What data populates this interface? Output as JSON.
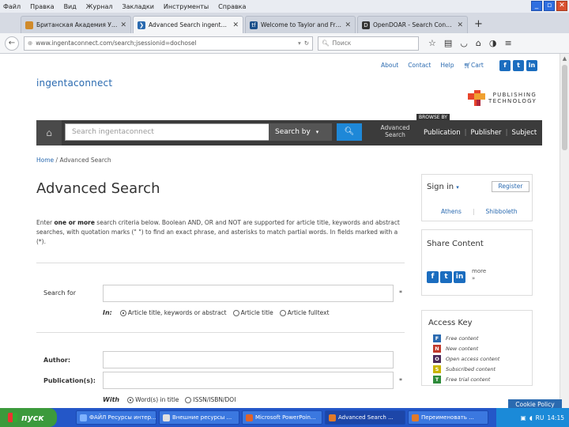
{
  "browser": {
    "menu": [
      "Файл",
      "Правка",
      "Вид",
      "Журнал",
      "Закладки",
      "Инструменты",
      "Справка"
    ],
    "window_buttons": [
      "_",
      "▫",
      "✕"
    ],
    "tabs": [
      {
        "title": "Британская Академия Уни...",
        "icon_color": "#d08a2a",
        "icon": "",
        "active": false
      },
      {
        "title": "Advanced Search ingentaco...",
        "icon_color": "#2a6ab0",
        "icon": "❯",
        "active": true
      },
      {
        "title": "Welcome to Taylor and Francis O...",
        "icon_color": "#1a4f8a",
        "icon": "tf",
        "active": false
      },
      {
        "title": "OpenDOAR - Search Content",
        "icon_color": "#333333",
        "icon": "D",
        "active": false
      }
    ],
    "new_tab": "+",
    "url": "www.ingentaconnect.com/search;jsessionid=dochosel",
    "search_placeholder": "Поиск"
  },
  "site": {
    "top_links": [
      "About",
      "Contact",
      "Help"
    ],
    "cart_label": "Cart",
    "social": [
      "f",
      "t",
      "in"
    ],
    "logo": "ingentaconnect",
    "publisher_logo": {
      "line1": "PUBLISHING",
      "line2": "TECHNOLOGY"
    },
    "browse_by_label": "BROWSE BY",
    "search_placeholder": "Search ingentaconnect",
    "search_by_label": "Search by",
    "advanced_search_line1": "Advanced",
    "advanced_search_line2": "Search",
    "browse_links": [
      "Publication",
      "Publisher",
      "Subject"
    ]
  },
  "main": {
    "breadcrumb_home": "Home",
    "breadcrumb_current": "/ Advanced Search",
    "title": "Advanced Search",
    "intro_p1": "Enter ",
    "intro_bold": "one or more",
    "intro_p2": " search criteria below. Boolean AND, OR and NOT are supported for article title, keywords and abstract searches, with quotation marks (\" \") to find an exact phrase, and asterisks to match partial words. In fields marked with a (*).",
    "search_for_label": "Search for",
    "in_label": "In:",
    "in_options": [
      {
        "label": "Article title, keywords or abstract",
        "selected": true
      },
      {
        "label": "Article title",
        "selected": false
      },
      {
        "label": "Article fulltext",
        "selected": false
      }
    ],
    "author_label": "Author:",
    "publication_label": "Publication(s):",
    "with_label": "With",
    "with_options": [
      {
        "label": "Word(s) in title",
        "selected": true
      },
      {
        "label": "ISSN/ISBN/DOI",
        "selected": false
      }
    ],
    "required_marker": "*"
  },
  "sidebar": {
    "signin_label": "Sign in",
    "signin_caret": "▾",
    "register_label": "Register",
    "athens_label": "Athens",
    "shibboleth_label": "Shibboleth",
    "share_title": "Share Content",
    "share_icons": [
      "f",
      "t",
      "in"
    ],
    "more_label_line1": "more",
    "more_label_line2": "»",
    "access_title": "Access Key",
    "access_items": [
      {
        "code": "F",
        "label": "Free content",
        "color": "#2a6ab0"
      },
      {
        "code": "N",
        "label": "New content",
        "color": "#c0392b"
      },
      {
        "code": "O",
        "label": "Open access content",
        "color": "#4a2a5a"
      },
      {
        "code": "S",
        "label": "Subscribed content",
        "color": "#c8b400"
      },
      {
        "code": "T",
        "label": "Free trial content",
        "color": "#2e8b3a"
      }
    ]
  },
  "cookie_policy": "Cookie Policy",
  "taskbar": {
    "start_label": "пуск",
    "tasks": [
      {
        "label": "ФАЙЛ Ресурсы интер...",
        "color": "#7fb3ff",
        "active": false
      },
      {
        "label": "Внешние ресурсы ...",
        "color": "#e0e0e0",
        "active": false
      },
      {
        "label": "Microsoft PowerPoin...",
        "color": "#e0632a",
        "active": false
      },
      {
        "label": "Advanced Search ...",
        "color": "#e07a2a",
        "active": true
      },
      {
        "label": "Переименовать ...",
        "color": "#e07a2a",
        "active": false
      }
    ],
    "tray_lang": "RU",
    "time": "14:15"
  }
}
